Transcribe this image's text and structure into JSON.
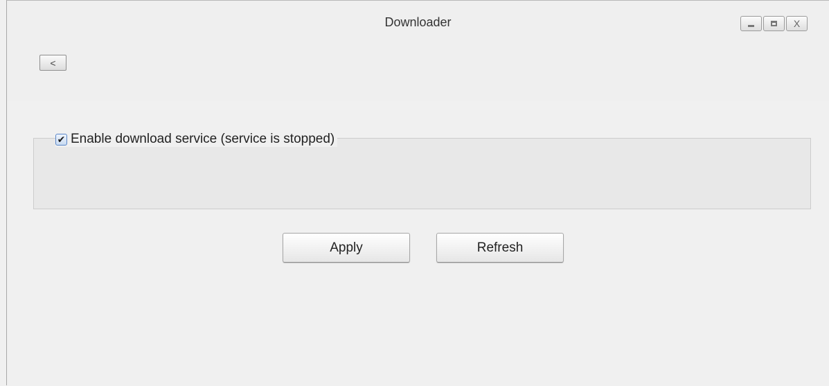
{
  "window": {
    "title": "Downloader",
    "controls": {
      "minimize_icon": "minimize-icon",
      "maximize_icon": "maximize-icon",
      "close_label": "X"
    },
    "back_label": "<"
  },
  "service": {
    "enabled": true,
    "label": "Enable download service (service is stopped)"
  },
  "actions": {
    "apply_label": "Apply",
    "refresh_label": "Refresh"
  }
}
